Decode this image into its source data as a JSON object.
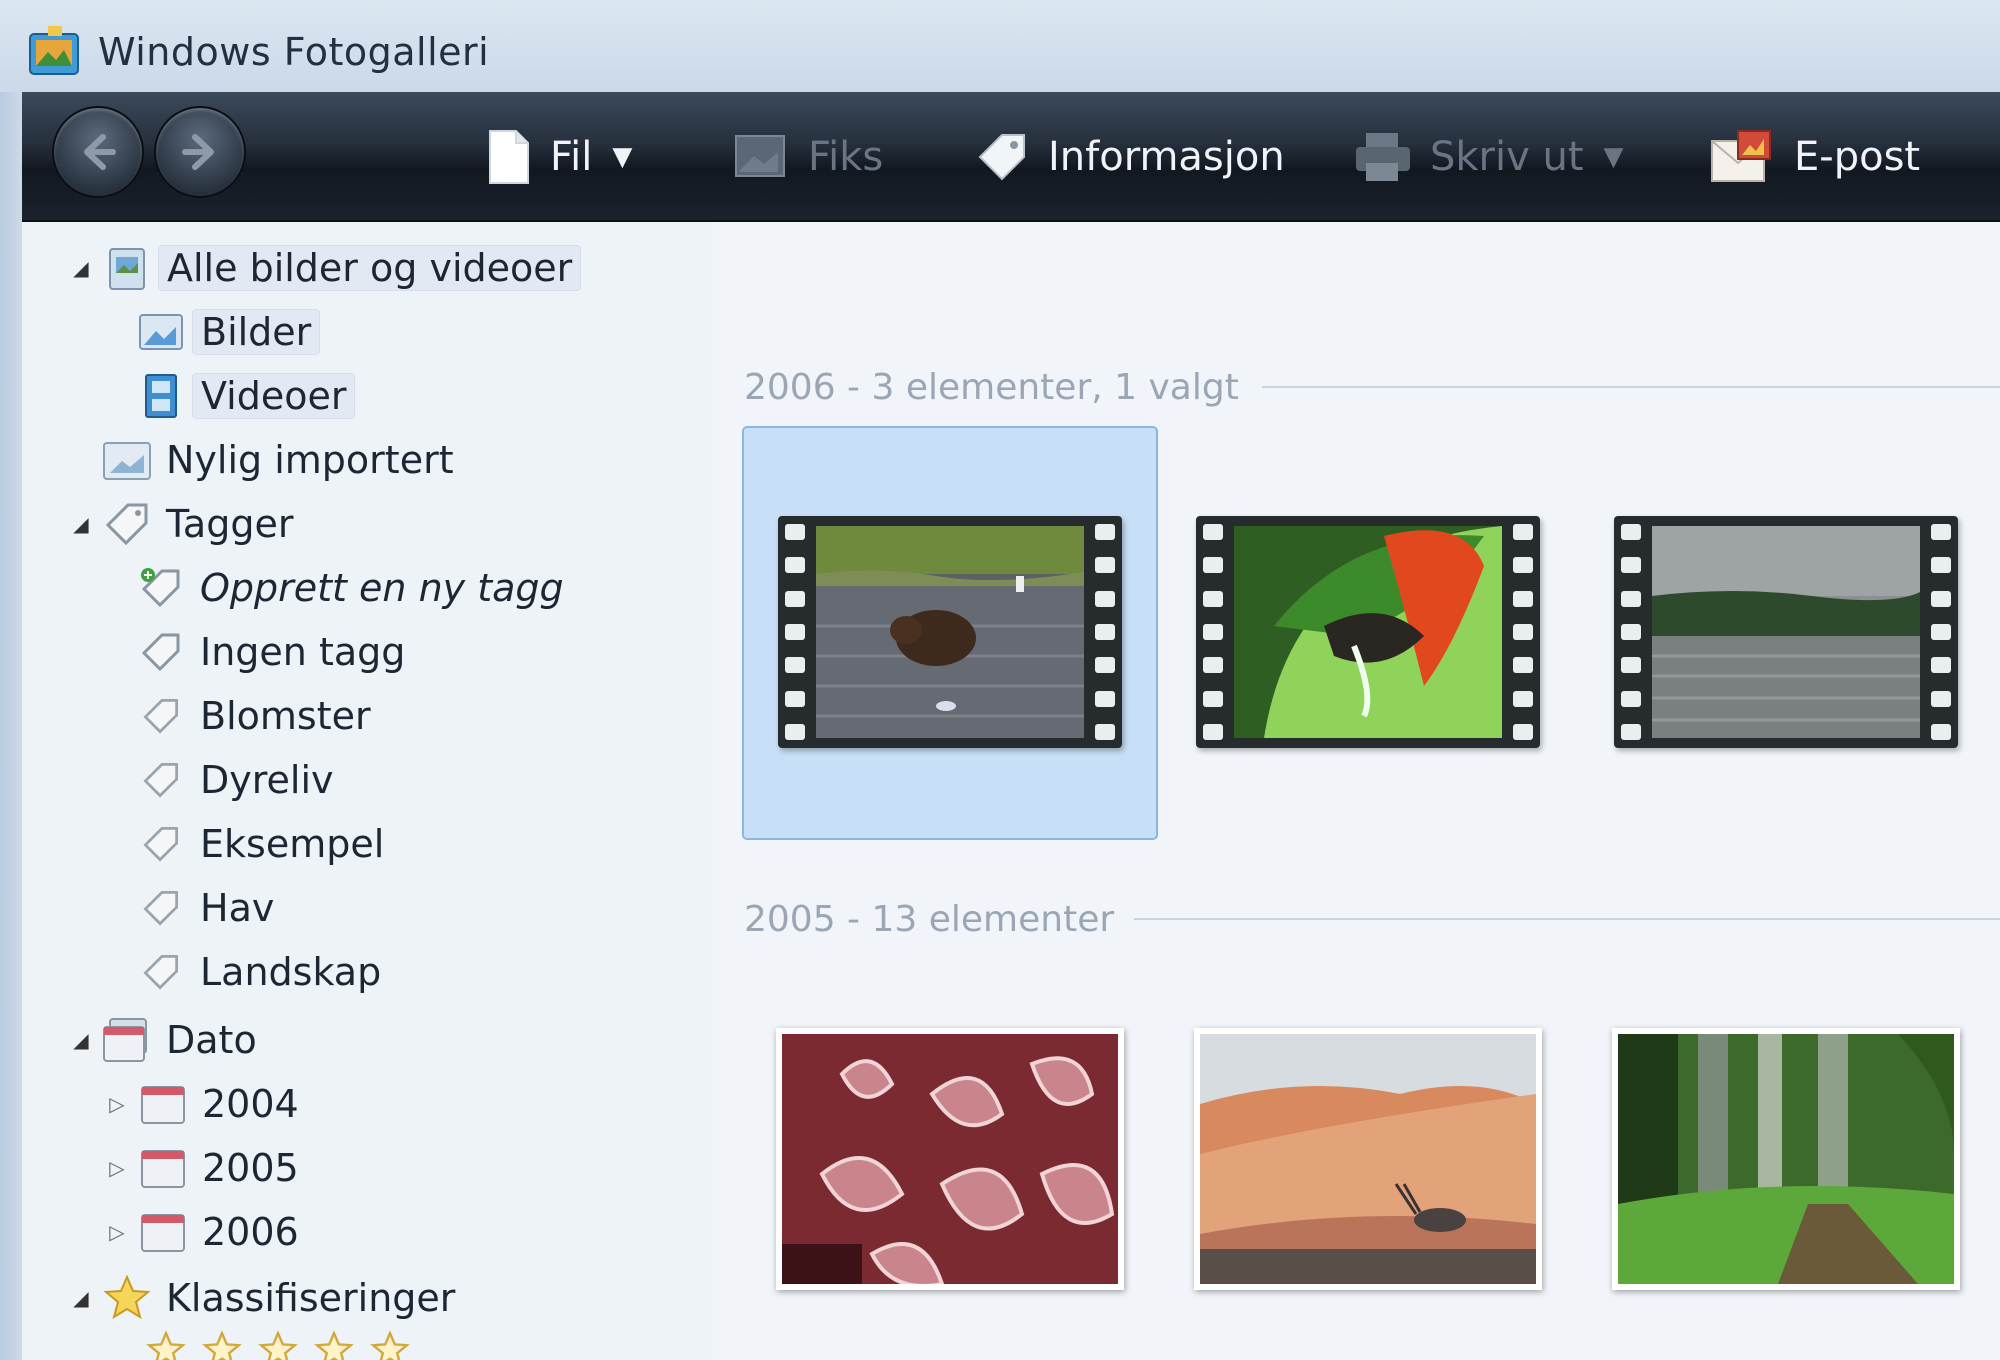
{
  "window": {
    "title": "Windows Fotogalleri"
  },
  "toolbar": {
    "file_label": "Fil",
    "fix_label": "Fiks",
    "info_label": "Informasjon",
    "print_label": "Skriv ut",
    "email_label": "E-post"
  },
  "sidebar": {
    "all": "Alle bilder og videoer",
    "pictures": "Bilder",
    "videos": "Videoer",
    "recent": "Nylig importert",
    "tags": "Tagger",
    "new_tag": "Opprett en ny tagg",
    "no_tag": "Ingen tagg",
    "tag_items": [
      "Blomster",
      "Dyreliv",
      "Eksempel",
      "Hav",
      "Landskap"
    ],
    "date": "Dato",
    "years": [
      "2004",
      "2005",
      "2006"
    ],
    "ratings": "Klassifiseringer"
  },
  "main": {
    "groups": [
      {
        "header": "2006 - 3 elementer, 1 valgt"
      },
      {
        "header": "2005 - 13 elementer"
      }
    ]
  },
  "colors": {
    "toolbar_dark": "#1b222c",
    "selection": "#c8e0f7",
    "sidebar_bg": "#eef3f8"
  }
}
